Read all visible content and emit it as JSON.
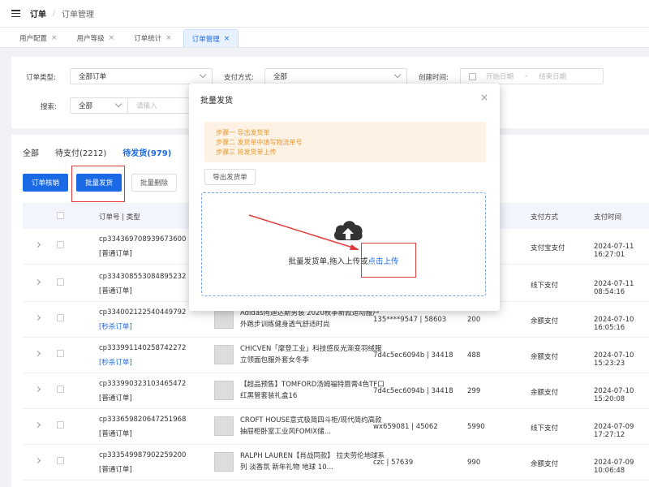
{
  "breadcrumb": {
    "main": "订单",
    "sub": "订单管理"
  },
  "tabs": [
    {
      "label": "用户配置"
    },
    {
      "label": "用户等级"
    },
    {
      "label": "订单统计"
    },
    {
      "label": "订单管理",
      "active": true
    }
  ],
  "filters": {
    "order_type_label": "订单类型:",
    "order_type_value": "全部订单",
    "pay_method_label": "支付方式:",
    "pay_method_value": "全部",
    "create_time_label": "创建时间:",
    "start_date_placeholder": "开始日期",
    "date_sep": "-",
    "end_date_placeholder": "结束日期",
    "search_label": "搜索:",
    "search_scope": "全部",
    "search_placeholder": "请输入"
  },
  "status_tabs": [
    {
      "label": "全部"
    },
    {
      "label": "待支付(2212)"
    },
    {
      "label": "待发货(979)",
      "active": true
    }
  ],
  "actions": {
    "verify": "订单核销",
    "batch_ship": "批量发货",
    "batch_delete": "批量删除"
  },
  "table": {
    "headers": {
      "order_no": "订单号 | 类型",
      "pay_method": "支付方式",
      "pay_time": "支付时间"
    },
    "rows": [
      {
        "order_no": "cp334369708939673600",
        "type": "[普通订单]",
        "type_color": "#333333",
        "goods": "",
        "user": "",
        "amount": "",
        "pay_method": "支付宝支付",
        "pay_time": "2024-07-11 16:27:01"
      },
      {
        "order_no": "cp334308553084895232",
        "type": "[普通订单]",
        "type_color": "#333333",
        "goods": "",
        "user": "",
        "amount": "",
        "pay_method": "线下支付",
        "pay_time": "2024-07-11 08:54:16"
      },
      {
        "order_no": "cp334002122540449792",
        "type": "[秒杀订单]",
        "type_color": "#1a6ae6",
        "goods": "Adidas阿迪达斯男装 2020秋季新款运动服户外跑步训练健身透气舒适时尚",
        "user": "135****9547 | 58603",
        "amount": "200",
        "pay_method": "余额支付",
        "pay_time": "2024-07-10 16:05:16"
      },
      {
        "order_no": "cp333991140258742272",
        "type": "[秒杀订单]",
        "type_color": "#1a6ae6",
        "goods": "CHICVEN「摩登工业」科技感反光渐变羽绒服立领面包服外套女冬季",
        "user": "7d4c5ec6094b | 34418",
        "amount": "488",
        "pay_method": "余额支付",
        "pay_time": "2024-07-10 15:23:23"
      },
      {
        "order_no": "cp333990323103465472",
        "type": "[普通订单]",
        "type_color": "#333333",
        "goods": "【超品预售】TOMFORD汤姆福特唇膏4色TF口红黑管套装礼盒16",
        "user": "7d4c5ec6094b | 34418",
        "amount": "299",
        "pay_method": "余额支付",
        "pay_time": "2024-07-10 15:20:08"
      },
      {
        "order_no": "cp333659820647251968",
        "type": "[普通订单]",
        "type_color": "#333333",
        "goods": "CROFT HOUSE意式极简四斗柜/现代简约高款抽屉柜卧室工业风FOMIX储...",
        "user": "wx659081 | 45062",
        "amount": "5990",
        "pay_method": "线下支付",
        "pay_time": "2024-07-09 17:27:12"
      },
      {
        "order_no": "cp333549987902259200",
        "type": "[普通订单]",
        "type_color": "#333333",
        "goods": "RALPH LAUREN【肖战同款】 拉夫劳伦地球系列 淡香氛 新年礼物 地球 10...",
        "user": "czc | 57639",
        "amount": "990",
        "pay_method": "余额支付",
        "pay_time": "2024-07-09 10:06:48"
      }
    ]
  },
  "modal": {
    "title": "批量发货",
    "close": "×",
    "steps": [
      "步骤一 导出发货单",
      "步骤二 发货单中填写物流单号",
      "步骤三 将发货单上传"
    ],
    "export_button": "导出发货单",
    "upload_text": "批量发货单,拖入上传或",
    "upload_link": "点击上传"
  },
  "colors": {
    "primary": "#1a6ae6",
    "highlight": "#e23c3c",
    "steps_bg": "#fdf2e4",
    "steps_text": "#e59a3a"
  }
}
